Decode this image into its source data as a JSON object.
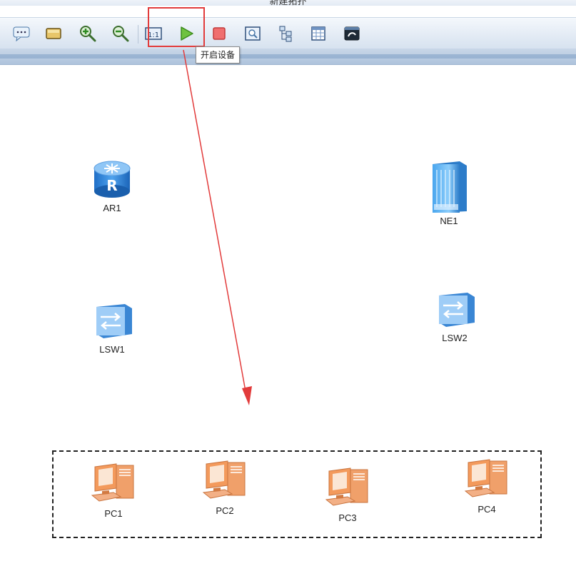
{
  "window": {
    "title": "新建拓扑"
  },
  "toolbar": {
    "buttons": [
      {
        "name": "text-note-button",
        "icon": "text-note-icon"
      },
      {
        "name": "rectangle-button",
        "icon": "rectangle-icon"
      },
      {
        "name": "zoom-in-button",
        "icon": "zoom-in-icon"
      },
      {
        "name": "zoom-out-button",
        "icon": "zoom-out-icon"
      },
      {
        "name": "fit-view-button",
        "icon": "fit-view-icon"
      },
      {
        "name": "start-device-button",
        "icon": "play-icon"
      },
      {
        "name": "stop-device-button",
        "icon": "stop-icon"
      },
      {
        "name": "capture-data-button",
        "icon": "capture-icon"
      },
      {
        "name": "topology-button",
        "icon": "topology-icon"
      },
      {
        "name": "interface-table-button",
        "icon": "table-icon"
      },
      {
        "name": "cli-button",
        "icon": "terminal-icon"
      }
    ],
    "tooltip": "开启设备",
    "highlight_color": "#e23b3b"
  },
  "canvas": {
    "devices": [
      {
        "id": "AR1",
        "type": "router"
      },
      {
        "id": "NE1",
        "type": "ne-router"
      },
      {
        "id": "LSW1",
        "type": "switch"
      },
      {
        "id": "LSW2",
        "type": "switch"
      },
      {
        "id": "PC1",
        "type": "pc"
      },
      {
        "id": "PC2",
        "type": "pc"
      },
      {
        "id": "PC3",
        "type": "pc"
      },
      {
        "id": "PC4",
        "type": "pc"
      }
    ],
    "annotation_arrow_color": "#e23b3b"
  }
}
